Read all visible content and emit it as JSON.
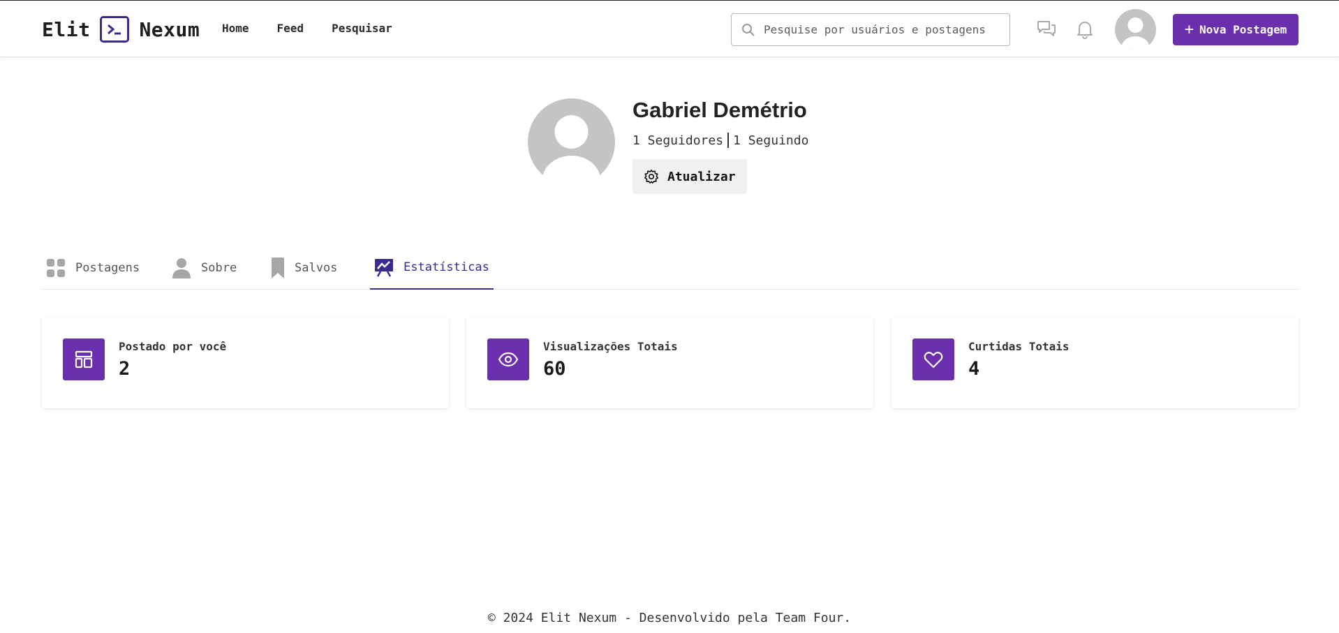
{
  "header": {
    "logo_left": "Elit",
    "logo_right": "Nexum",
    "nav": [
      "Home",
      "Feed",
      "Pesquisar"
    ],
    "search_placeholder": "Pesquise por usuários e postagens",
    "new_post_label": "Nova Postagem"
  },
  "profile": {
    "name": "Gabriel Demétrio",
    "followers": "1 Seguidores",
    "following": "1 Seguindo",
    "update_label": "Atualizar"
  },
  "tabs": [
    {
      "label": "Postagens",
      "icon": "grid-icon",
      "active": false
    },
    {
      "label": "Sobre",
      "icon": "person-icon",
      "active": false
    },
    {
      "label": "Salvos",
      "icon": "bookmark-icon",
      "active": false
    },
    {
      "label": "Estatísticas",
      "icon": "chart-icon",
      "active": true
    }
  ],
  "stats": [
    {
      "label": "Postado por você",
      "value": "2",
      "icon": "layout-icon"
    },
    {
      "label": "Visualizações Totais",
      "value": "60",
      "icon": "eye-icon"
    },
    {
      "label": "Curtidas Totais",
      "value": "4",
      "icon": "heart-icon"
    }
  ],
  "footer": "© 2024 Elit Nexum - Desenvolvido pela Team Four.",
  "colors": {
    "accent": "#6b2fae",
    "active_tab": "#3a2b8c"
  }
}
